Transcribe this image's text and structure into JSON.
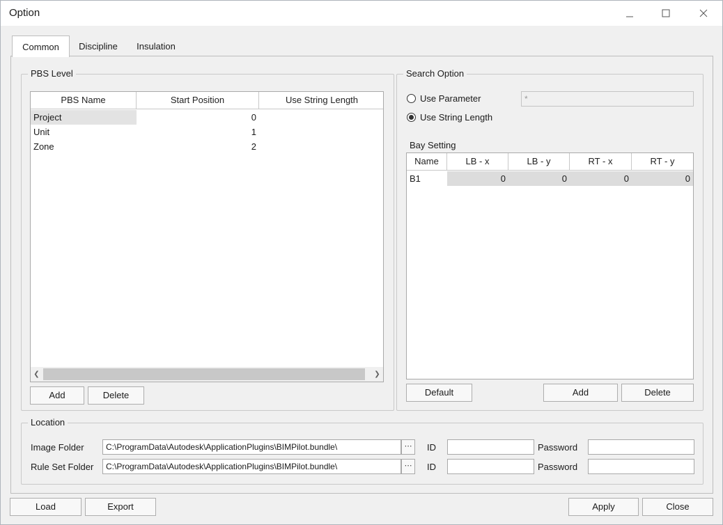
{
  "window": {
    "title": "Option",
    "controls": {
      "minimize_icon": "minimize-icon",
      "maximize_icon": "maximize-icon",
      "close_icon": "close-icon"
    }
  },
  "tabs": [
    {
      "label": "Common",
      "active": true
    },
    {
      "label": "Discipline",
      "active": false
    },
    {
      "label": "Insulation",
      "active": false
    }
  ],
  "pbs_level": {
    "title": "PBS Level",
    "columns": [
      "PBS Name",
      "Start Position",
      "Use String Length"
    ],
    "rows": [
      {
        "name": "Project",
        "start": "0",
        "length": ""
      },
      {
        "name": "Unit",
        "start": "1",
        "length": ""
      },
      {
        "name": "Zone",
        "start": "2",
        "length": ""
      }
    ],
    "add_label": "Add",
    "delete_label": "Delete"
  },
  "search_option": {
    "title": "Search Option",
    "use_parameter_label": "Use Parameter",
    "use_parameter_value": "*",
    "use_string_length_label": "Use String Length",
    "selected": "use_string_length"
  },
  "bay_setting": {
    "title": "Bay Setting",
    "columns": [
      "Name",
      "LB - x",
      "LB - y",
      "RT - x",
      "RT - y"
    ],
    "rows": [
      {
        "name": "B1",
        "lbx": "0",
        "lby": "0",
        "rtx": "0",
        "rty": "0"
      }
    ],
    "default_label": "Default",
    "add_label": "Add",
    "delete_label": "Delete"
  },
  "location": {
    "title": "Location",
    "image_folder_label": "Image Folder",
    "image_folder_value": "C:\\ProgramData\\Autodesk\\ApplicationPlugins\\BIMPilot.bundle\\",
    "rule_set_folder_label": "Rule Set Folder",
    "rule_set_folder_value": "C:\\ProgramData\\Autodesk\\ApplicationPlugins\\BIMPilot.bundle\\",
    "browse_label": "⋯",
    "id_label": "ID",
    "password_label": "Password",
    "image_id_value": "",
    "image_password_value": "",
    "rule_id_value": "",
    "rule_password_value": ""
  },
  "footer": {
    "load_label": "Load",
    "export_label": "Export",
    "apply_label": "Apply",
    "close_label": "Close"
  }
}
